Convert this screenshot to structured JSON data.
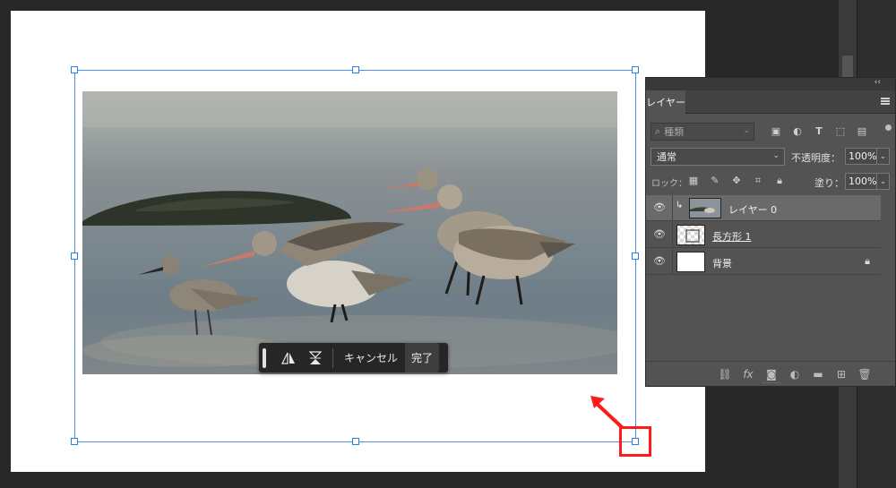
{
  "task_bar": {
    "flip_horizontal_icon": "flip-horizontal",
    "flip_vertical_icon": "flip-vertical",
    "cancel_label": "キャンセル",
    "done_label": "完了"
  },
  "layers_panel": {
    "tab_label": "レイヤー",
    "collapse_glyph": "‹‹",
    "filter": {
      "placeholder": "種類",
      "icons": [
        "image-filter-icon",
        "adjustment-filter-icon",
        "type-filter-icon",
        "shape-filter-icon",
        "smart-object-filter-icon"
      ]
    },
    "blend_mode": "通常",
    "opacity_label": "不透明度：",
    "opacity_value": "100%",
    "lock_label": "ロック：",
    "fill_label": "塗り：",
    "fill_value": "100%",
    "layers": [
      {
        "name": "レイヤー 0",
        "selected": true,
        "clipped": true
      },
      {
        "name": "長方形 1",
        "selected": false,
        "clipped": false
      },
      {
        "name": "背景",
        "selected": false,
        "clipped": false,
        "locked": true
      }
    ]
  },
  "colors": {
    "selection_blue": "#4a90e2",
    "annotation_red": "#ff1a1a",
    "panel_bg": "#535353",
    "workspace_bg": "#282828"
  }
}
